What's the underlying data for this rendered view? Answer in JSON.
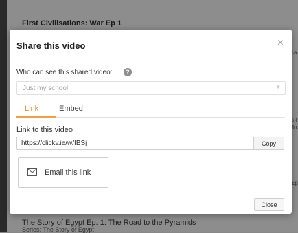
{
  "background": {
    "top_title": "First Civilisations: War Ep 1",
    "bottom_title": "The Story of Egypt Ep. 1: The Road to the Pyramids",
    "bottom_series": "Series: The Story of Egypt",
    "right_fragments": [
      "ca",
      "s (",
      "flu",
      "Ep"
    ]
  },
  "modal": {
    "title": "Share this video",
    "close_icon": "×",
    "who_label": "Who can see this shared video:",
    "help_icon": "?",
    "audience_select": {
      "value": "Just my school"
    },
    "tabs": [
      {
        "label": "Link",
        "active": true
      },
      {
        "label": "Embed",
        "active": false
      }
    ],
    "link_label": "Link to this video",
    "link_value": "https://clickv.ie/w/IBSj",
    "copy_label": "Copy",
    "email_label": "Email this link",
    "close_label": "Close"
  },
  "colors": {
    "accent": "#e88b2c",
    "overlay": "#8d8d8d"
  }
}
